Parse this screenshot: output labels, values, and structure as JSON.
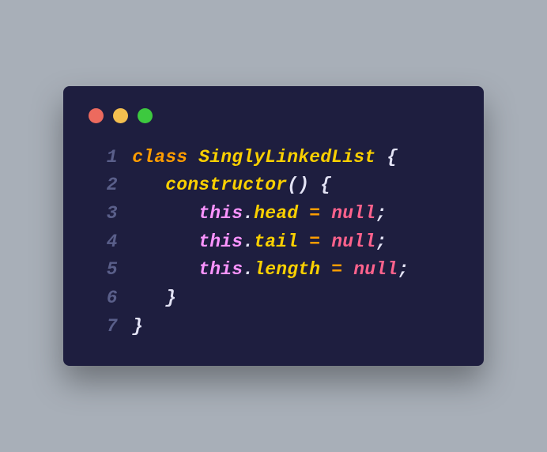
{
  "window": {
    "buttons": [
      "close",
      "minimize",
      "zoom"
    ]
  },
  "colors": {
    "background": "#a8afb8",
    "editor_bg": "#1e1e3f",
    "close": "#ec6a5e",
    "minimize": "#f4bf4f",
    "zoom": "#3dc93f",
    "line_number": "#5a5f8a",
    "keyword": "#ff9d00",
    "classname": "#fad000",
    "punctuation": "#e3e3f5",
    "this": "#fb94ff",
    "property": "#fad000",
    "operator": "#ff9d00",
    "null": "#ff628c"
  },
  "code": {
    "line_numbers": [
      "1",
      "2",
      "3",
      "4",
      "5",
      "6",
      "7"
    ],
    "tokens": {
      "kw_class": "class",
      "cls_name": "SinglyLinkedList",
      "brace_open": "{",
      "brace_close": "}",
      "constructor": "constructor",
      "paren_open": "(",
      "paren_close": ")",
      "this": "this",
      "dot": ".",
      "prop_head": "head",
      "prop_tail": "tail",
      "prop_length": "length",
      "eq": "=",
      "null": "null",
      "semi": ";",
      "sp": " ",
      "indent1": "   ",
      "indent2": "      "
    }
  }
}
